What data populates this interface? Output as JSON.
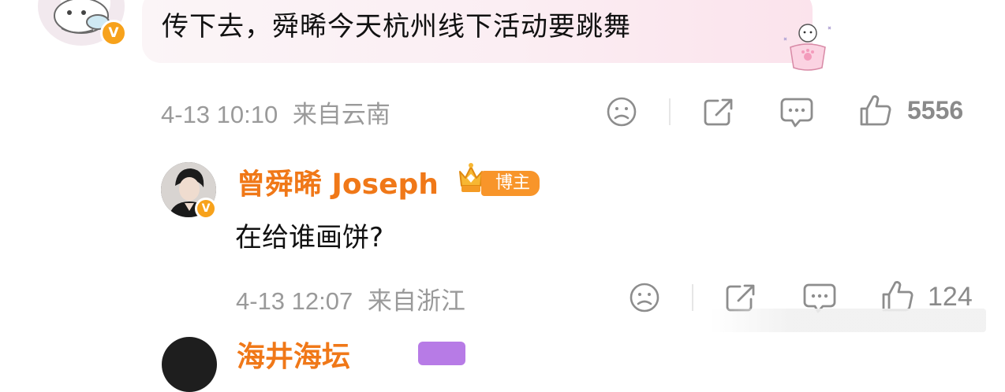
{
  "comment": {
    "text": "传下去，舜晞今天杭州线下活动要跳舞",
    "time": "4-13 10:10",
    "location": "来自云南",
    "likes": "5556",
    "verified_badge": "V"
  },
  "reply": {
    "username": "曾舜晞 Joseph",
    "badge_label": "博主",
    "text": "在给谁画饼?",
    "time": "4-13 12:07",
    "location": "来自浙江",
    "likes": "124",
    "verified_badge": "V"
  },
  "next_reply": {
    "username": "海井海坛"
  },
  "icons": {
    "dislike": "frown-face-icon",
    "share": "share-icon",
    "comment": "comment-icon",
    "like": "thumbs-up-icon"
  },
  "colors": {
    "accent_orange": "#f07818",
    "badge_orange": "#f8952a",
    "meta_gray": "#9a9a9a",
    "bubble_pink": "#fbeef3"
  }
}
